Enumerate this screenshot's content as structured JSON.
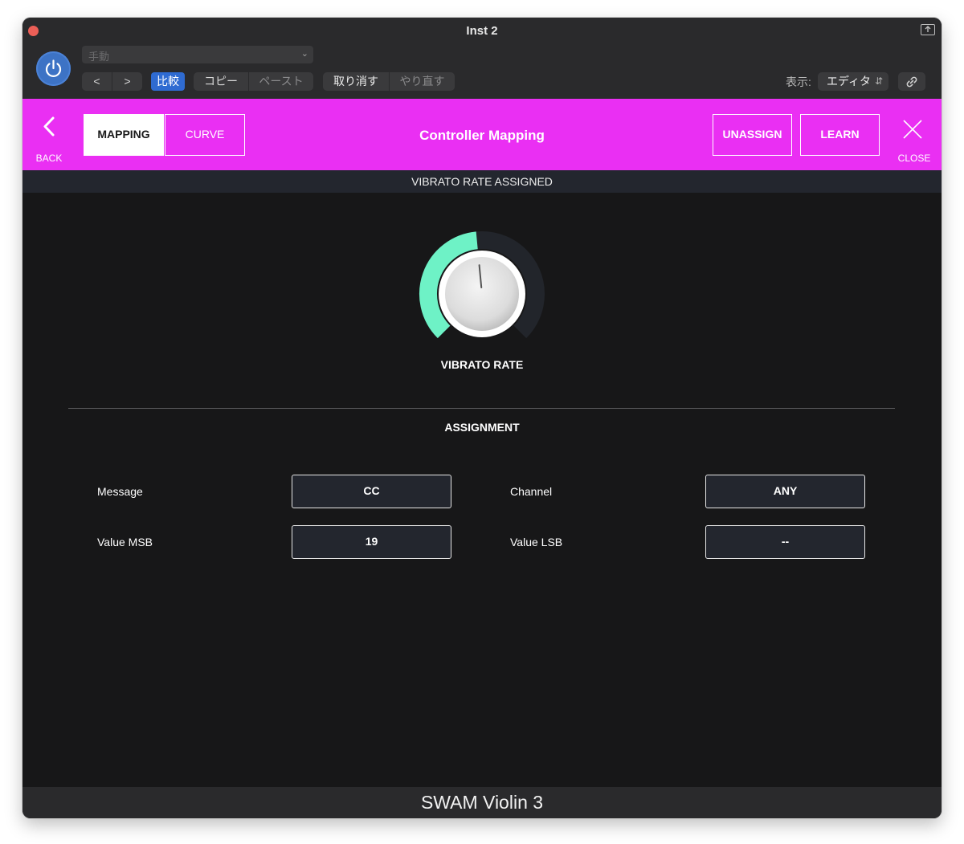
{
  "window": {
    "title": "Inst 2"
  },
  "toolbar": {
    "preset_value": "手動",
    "nav_prev_label": "<",
    "nav_next_label": ">",
    "compare_label": "比較",
    "copy_label": "コピー",
    "paste_label": "ペースト",
    "undo_label": "取り消す",
    "redo_label": "やり直す",
    "view_label": "表示:",
    "view_value": "エディタ"
  },
  "header": {
    "back_label": "BACK",
    "tabs": [
      {
        "label": "MAPPING",
        "active": true
      },
      {
        "label": "CURVE",
        "active": false
      }
    ],
    "title": "Controller Mapping",
    "unassign_label": "UNASSIGN",
    "learn_label": "LEARN",
    "close_label": "CLOSE",
    "accent_color": "#ea2ff3"
  },
  "status": {
    "text": "VIBRATO RATE ASSIGNED"
  },
  "knob": {
    "label": "VIBRATO RATE",
    "level": 0.48,
    "arc_color": "#6ef2c6"
  },
  "assignment": {
    "title": "ASSIGNMENT",
    "fields": [
      {
        "label": "Message",
        "value": "CC"
      },
      {
        "label": "Channel",
        "value": "ANY"
      },
      {
        "label": "Value MSB",
        "value": "19"
      },
      {
        "label": "Value LSB",
        "value": "--"
      }
    ]
  },
  "footer": {
    "text": "SWAM Violin 3"
  }
}
